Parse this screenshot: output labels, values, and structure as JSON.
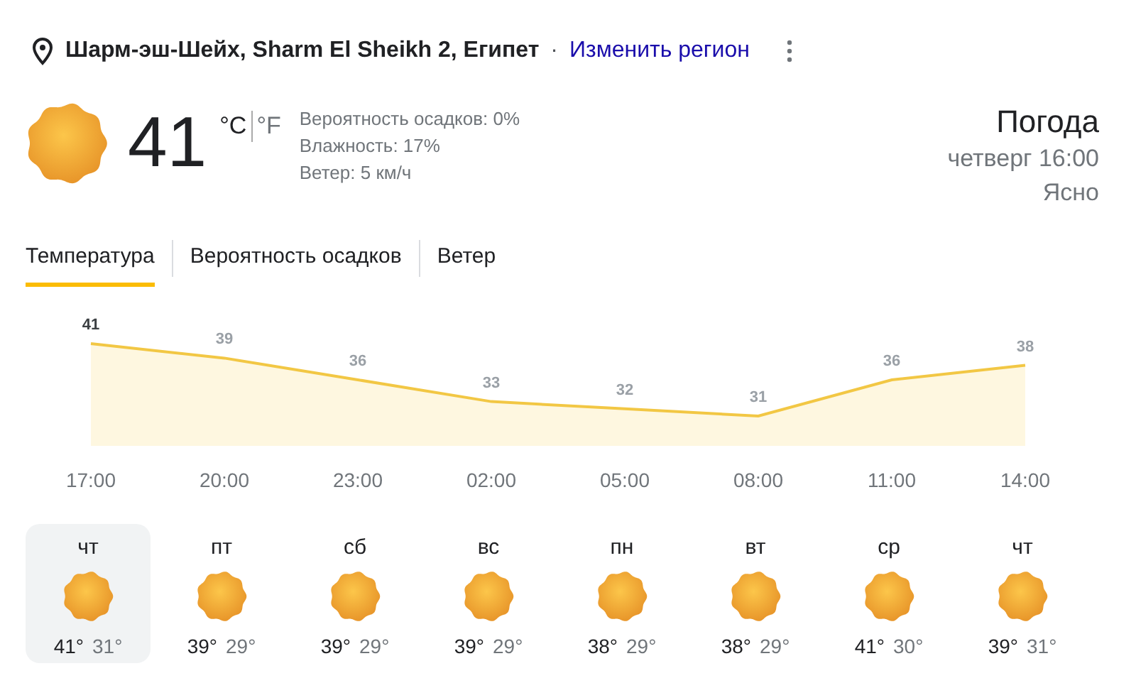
{
  "location": {
    "place": "Шарм-эш-Шейх, Sharm El Sheikh 2, Египет",
    "separator": "·",
    "change_link": "Изменить регион"
  },
  "current": {
    "temperature": "41",
    "units": [
      {
        "label": "°C",
        "selected": true
      },
      {
        "label": "°F",
        "selected": false
      }
    ],
    "details": [
      "Вероятность осадков: 0%",
      "Влажность: 17%",
      "Ветер: 5 км/ч"
    ]
  },
  "summary": {
    "title": "Погода",
    "time": "четверг 16:00",
    "condition": "Ясно"
  },
  "tabs": [
    {
      "label": "Температура",
      "selected": true
    },
    {
      "label": "Вероятность осадков",
      "selected": false
    },
    {
      "label": "Ветер",
      "selected": false
    }
  ],
  "chart_data": {
    "type": "area",
    "categories": [
      "17:00",
      "20:00",
      "23:00",
      "02:00",
      "05:00",
      "08:00",
      "11:00",
      "14:00"
    ],
    "values": [
      41,
      39,
      36,
      33,
      32,
      31,
      36,
      38
    ],
    "data_labels": true
  },
  "days": [
    {
      "day": "чт",
      "high": "41°",
      "low": "31°",
      "selected": true
    },
    {
      "day": "пт",
      "high": "39°",
      "low": "29°",
      "selected": false
    },
    {
      "day": "сб",
      "high": "39°",
      "low": "29°",
      "selected": false
    },
    {
      "day": "вс",
      "high": "39°",
      "low": "29°",
      "selected": false
    },
    {
      "day": "пн",
      "high": "38°",
      "low": "29°",
      "selected": false
    },
    {
      "day": "вт",
      "high": "38°",
      "low": "29°",
      "selected": false
    },
    {
      "day": "ср",
      "high": "41°",
      "low": "30°",
      "selected": false
    },
    {
      "day": "чт",
      "high": "39°",
      "low": "31°",
      "selected": false
    }
  ]
}
